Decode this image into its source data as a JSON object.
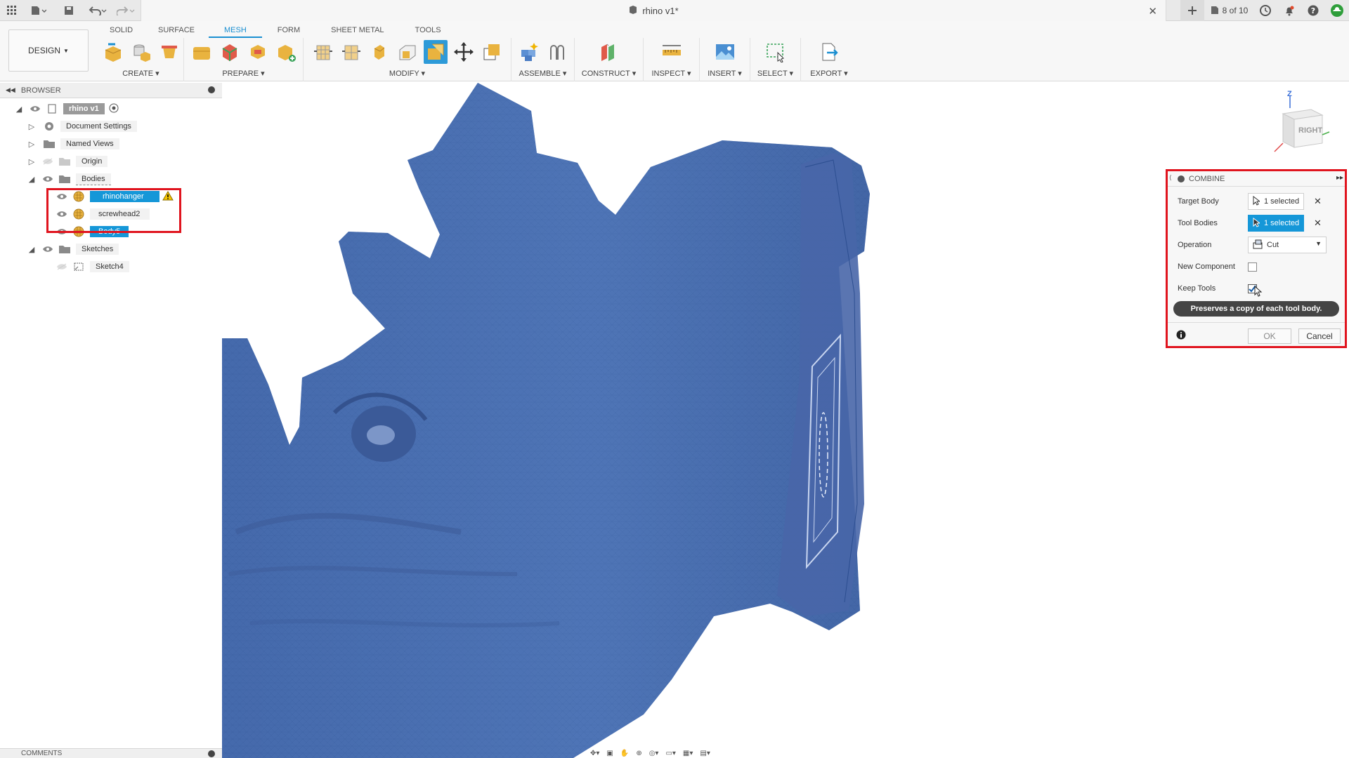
{
  "window": {
    "doc_title": "rhino v1*",
    "jobs_text": "8 of 10"
  },
  "ribbon": {
    "workspace": "DESIGN",
    "tabs": [
      "SOLID",
      "SURFACE",
      "MESH",
      "FORM",
      "SHEET METAL",
      "TOOLS"
    ],
    "active_tab": "MESH",
    "groups": [
      "CREATE",
      "PREPARE",
      "MODIFY",
      "ASSEMBLE",
      "CONSTRUCT",
      "INSPECT",
      "INSERT",
      "SELECT",
      "EXPORT"
    ]
  },
  "browser": {
    "title": "BROWSER",
    "root": "rhino v1",
    "items": {
      "doc_settings": "Document Settings",
      "named_views": "Named Views",
      "origin": "Origin",
      "bodies": "Bodies",
      "body1": "rhinohanger",
      "body2": "screwhead2",
      "body3": "Body5",
      "sketches": "Sketches",
      "sketch1": "Sketch4"
    }
  },
  "comments": {
    "title": "COMMENTS"
  },
  "viewcube": {
    "face_label": "RIGHT",
    "axis_z": "Z"
  },
  "combine": {
    "title": "COMBINE",
    "target_body_label": "Target Body",
    "target_body_value": "1 selected",
    "tool_bodies_label": "Tool Bodies",
    "tool_bodies_value": "1 selected",
    "operation_label": "Operation",
    "operation_value": "Cut",
    "new_component_label": "New Component",
    "new_component_checked": false,
    "keep_tools_label": "Keep Tools",
    "keep_tools_checked": true,
    "tooltip": "Preserves a copy of each tool body.",
    "ok": "OK",
    "cancel": "Cancel"
  },
  "colors": {
    "accent": "#1597d8",
    "highlight_box": "#e0141e",
    "mesh": "#4a6fb0"
  }
}
